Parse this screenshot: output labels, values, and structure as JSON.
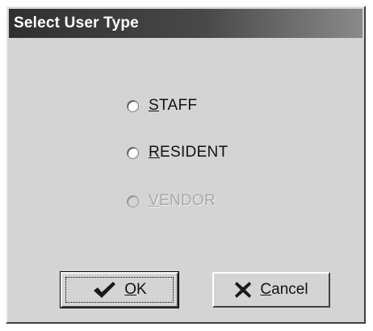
{
  "window": {
    "title": "Select User Type"
  },
  "options": [
    {
      "label_accel": "S",
      "label_rest": "TAFF",
      "enabled": true
    },
    {
      "label_accel": "R",
      "label_rest": "ESIDENT",
      "enabled": true
    },
    {
      "label_accel": "V",
      "label_rest": "ENDOR",
      "enabled": false
    }
  ],
  "buttons": {
    "ok": {
      "accel": "O",
      "rest": "K",
      "icon": "checkmark-icon"
    },
    "cancel": {
      "accel": "C",
      "rest": "ancel",
      "icon": "x-icon"
    }
  },
  "colors": {
    "face": "#d4d4d4",
    "title_bg": "#303030",
    "disabled_text": "#a8a8a8"
  }
}
